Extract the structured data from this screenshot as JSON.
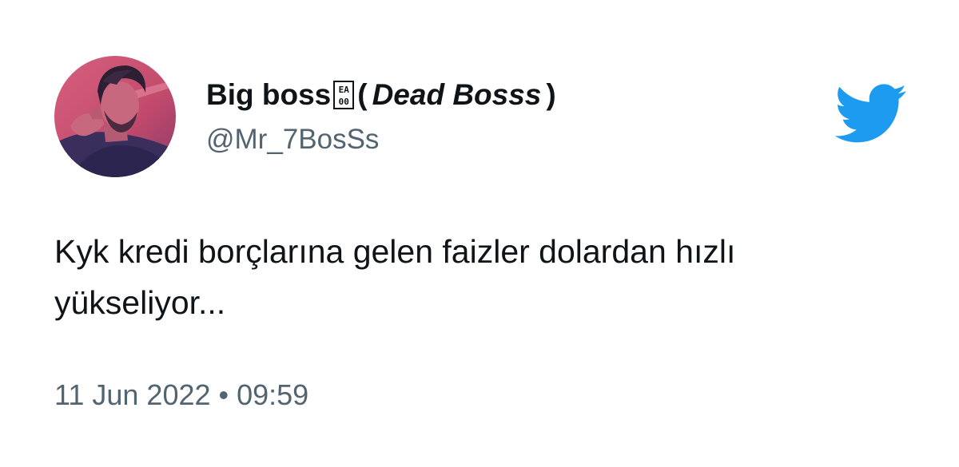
{
  "tweet": {
    "author": {
      "display_name": "Big boss",
      "emoji_glyph_top": "EA",
      "emoji_glyph_bottom": "00",
      "nickname_open": "(",
      "nickname": "Dead Bosss",
      "nickname_close": ")",
      "handle": "@Mr_7BosSs"
    },
    "text": "Kyk kredi borçlarına gelen faizler dolardan hızlı\nyükseliyor...",
    "timestamp": "11 Jun 2022 • 09:59",
    "logo_icon": "twitter-bird-icon",
    "colors": {
      "brand": "#1d9bf0",
      "secondary_text": "#536471",
      "primary_text": "#0f1419",
      "avatar_tint": "#c94b6d"
    }
  }
}
